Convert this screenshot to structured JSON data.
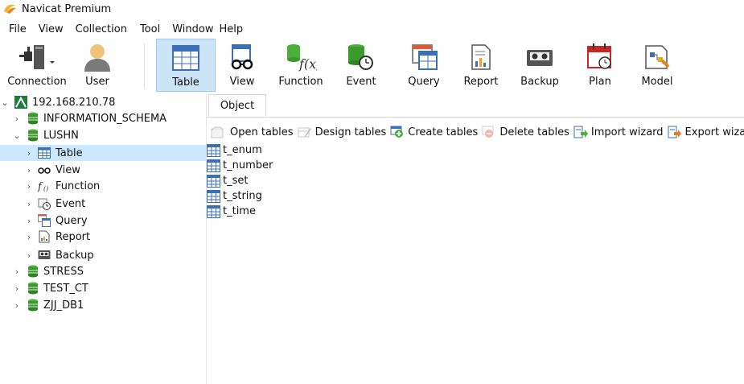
{
  "app": {
    "title": "Navicat Premium"
  },
  "menu": [
    "File",
    "View",
    "Collection",
    "Tool",
    "Window",
    "Help"
  ],
  "toolbar": {
    "connection": "Connection",
    "user": "User",
    "table": "Table",
    "view": "View",
    "function": "Function",
    "event": "Event",
    "query": "Query",
    "report": "Report",
    "backup": "Backup",
    "plan": "Plan",
    "model": "Model"
  },
  "tree": {
    "connection": "192.168.210.78",
    "dbs": [
      "INFORMATION_SCHEMA",
      "LUSHN",
      "STRESS",
      "TEST_CT",
      "ZJJ_DB1"
    ],
    "children": [
      "Table",
      "View",
      "Function",
      "Event",
      "Query",
      "Report",
      "Backup"
    ]
  },
  "tabs": {
    "object": "Object"
  },
  "objtoolbar": {
    "open": "Open tables",
    "design": "Design tables",
    "create": "Create tables",
    "delete": "Delete tables",
    "import": "Import wizard",
    "export": "Export wizard"
  },
  "objects": [
    "t_enum",
    "t_number",
    "t_set",
    "t_string",
    "t_time"
  ],
  "colors": {
    "selected": "#cce8ff",
    "db_green": "#3a9a2b",
    "accent": "#99c9ef"
  }
}
